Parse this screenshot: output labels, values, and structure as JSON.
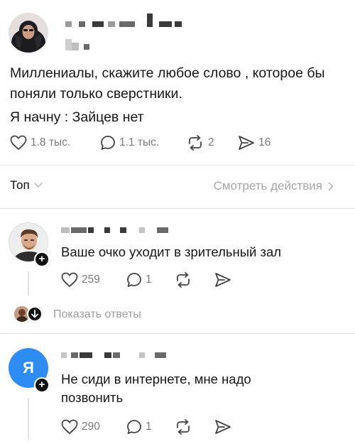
{
  "post": {
    "text_line1": "Миллениалы, скажите любое слово , которое бы",
    "text_line2": "поняли только сверстники.",
    "text_line3": "Я начну : Зайцев нет",
    "likes": "1.8 тыс.",
    "comments": "1.1 тыс.",
    "reposts": "2",
    "shares": "16"
  },
  "sort": {
    "label": "Топ",
    "actions_link": "Смотреть действия"
  },
  "comments": [
    {
      "text": "Ваше очко уходит в зрительный зал",
      "likes": "259",
      "replies_count": "1",
      "show_replies": "Показать ответы"
    },
    {
      "avatar_letter": "Я",
      "text_line1": "Не сиди в интернете, мне надо",
      "text_line2": "позвонить",
      "likes": "290",
      "replies_count": "1"
    }
  ],
  "icons": {
    "like": "heart-icon",
    "comment": "speech-bubble-icon",
    "repost": "repost-arrows-icon",
    "share": "paper-plane-icon",
    "sort_chevron": "chevron-down-icon",
    "link_chevron": "chevron-right-icon",
    "follow": "plus-icon",
    "replies_toggle": "arrow-down-icon"
  },
  "colors": {
    "avatar_blue": "#2f8cf2",
    "muted_text": "#9d9d9d",
    "divider": "#e6e6e6"
  }
}
